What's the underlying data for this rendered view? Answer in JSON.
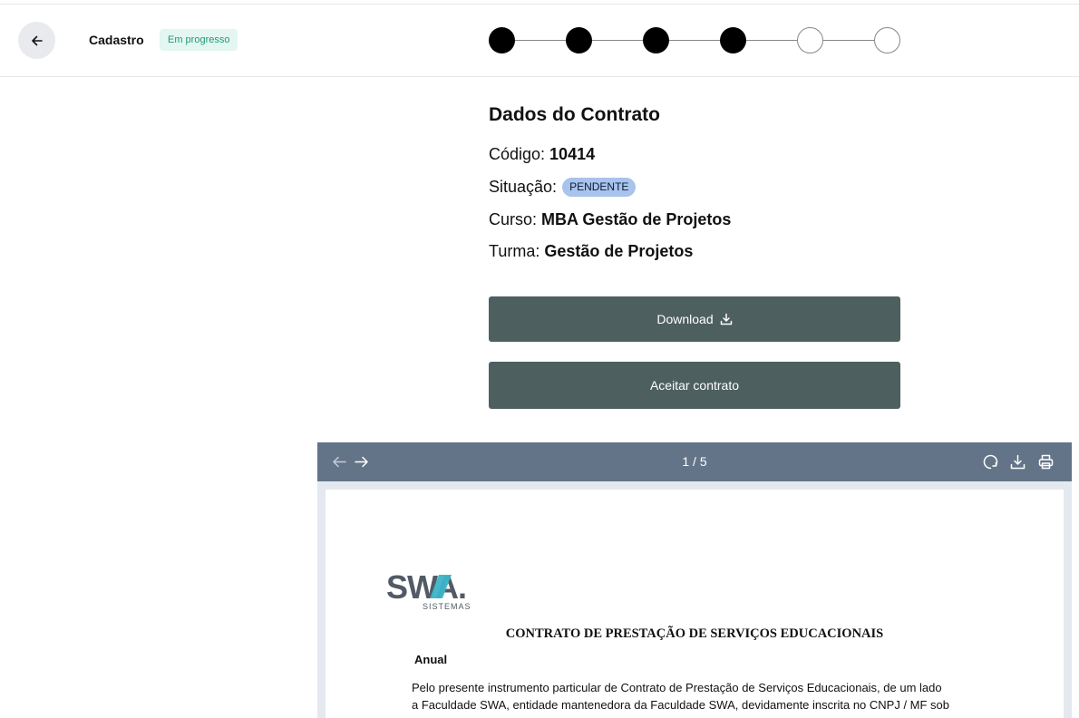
{
  "header": {
    "title": "Cadastro",
    "status": "Em progresso",
    "steps": [
      {
        "state": "done"
      },
      {
        "state": "done"
      },
      {
        "state": "done"
      },
      {
        "state": "done"
      },
      {
        "state": "todo"
      },
      {
        "state": "todo"
      }
    ]
  },
  "contract": {
    "section_title": "Dados do Contrato",
    "codigo_label": "Código:",
    "codigo_value": "10414",
    "situacao_label": "Situação:",
    "situacao_value": "PENDENTE",
    "curso_label": "Curso:",
    "curso_value": "MBA Gestão de Projetos",
    "turma_label": "Turma:",
    "turma_value": "Gestão de Projetos"
  },
  "actions": {
    "download_label": "Download",
    "accept_label": "Aceitar contrato"
  },
  "viewer": {
    "page_indicator": "1 / 5",
    "logo_text": "SWA.",
    "logo_sub": "SISTEMAS",
    "doc_title": "CONTRATO DE PRESTAÇÃO DE SERVIÇOS EDUCACIONAIS",
    "doc_subtitle": "Anual",
    "doc_line1": "Pelo presente instrumento particular de Contrato de Prestação de Serviços Educacionais, de um lado",
    "doc_line2": "a Faculdade SWA, entidade mantenedora da Faculdade SWA, devidamente inscrita no CNPJ / MF sob"
  },
  "colors": {
    "accent_button": "#4e5f60",
    "viewer_toolbar": "#647488",
    "status_badge_bg": "#e3f6f1",
    "status_badge_text": "#1e9b78",
    "pill_bg": "#a8c3ec"
  }
}
